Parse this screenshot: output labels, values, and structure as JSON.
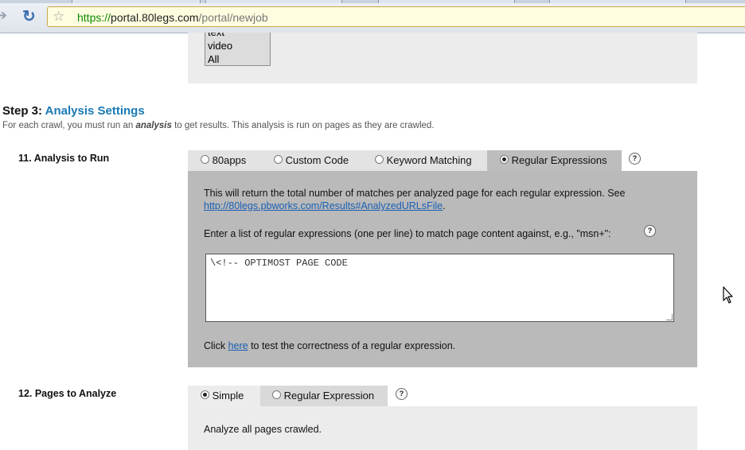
{
  "browser": {
    "url_scheme": "https://",
    "url_host": "portal.80legs.com",
    "url_path": "/portal/newjob"
  },
  "media_types": {
    "items": [
      "text",
      "video",
      "All"
    ]
  },
  "step3": {
    "step_label": "Step 3:",
    "title": "Analysis Settings",
    "desc_before": "For each crawl, you must run an ",
    "desc_emphasis": "analysis",
    "desc_after": " to get results. This analysis is run on pages as they are crawled."
  },
  "analysis_to_run": {
    "label": "11.  Analysis to Run",
    "tabs": [
      {
        "label": "80apps",
        "selected": false
      },
      {
        "label": "Custom Code",
        "selected": false
      },
      {
        "label": "Keyword Matching",
        "selected": false
      },
      {
        "label": "Regular Expressions",
        "selected": true
      }
    ],
    "help": "?",
    "description": "This will return the total number of matches per analyzed page for each regular expression. See",
    "results_link": "http://80legs.pbworks.com/Results#AnalyzedURLsFile",
    "results_link_suffix": ".",
    "prompt": "Enter a list of regular expressions (one per line) to match page content against, e.g., \"msn+\":",
    "regex_value": "\\<!-- OPTIMOST PAGE CODE",
    "test_prefix": "Click ",
    "test_link": "here",
    "test_suffix": " to test the correctness of a regular expression."
  },
  "pages_to_analyze": {
    "label": "12.  Pages to Analyze",
    "tabs": [
      {
        "label": "Simple",
        "selected": true
      },
      {
        "label": "Regular Expression",
        "selected": false
      }
    ],
    "help": "?",
    "text": "Analyze all pages crawled."
  },
  "colors": {
    "accent": "#1a7ab6",
    "selected_panel": "#bababa",
    "inactive_tab": "#e3e3e3"
  }
}
